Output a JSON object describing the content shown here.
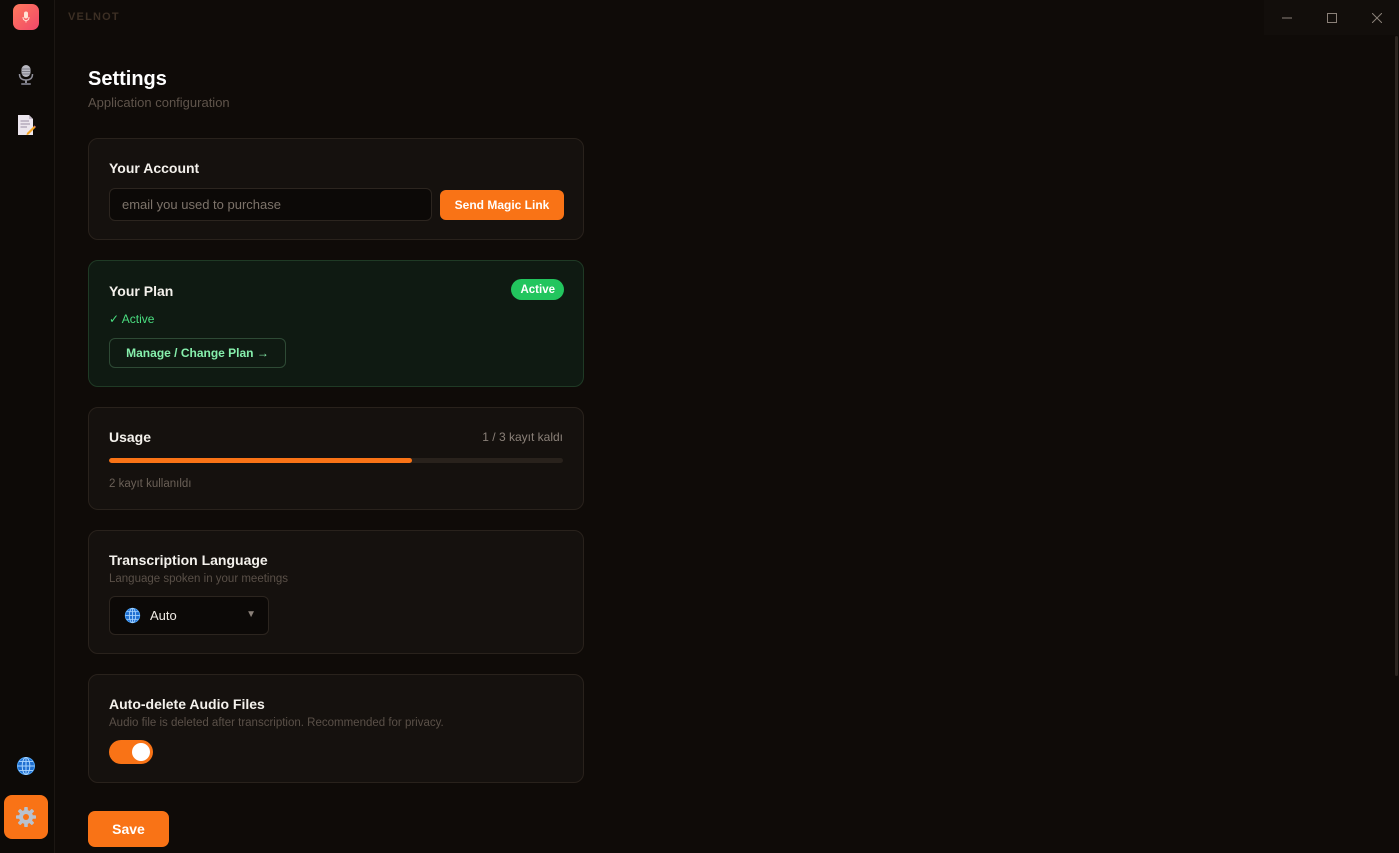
{
  "app": {
    "brand": "VELNOT"
  },
  "sidebar": {
    "items": [
      {
        "icon": "microphone-icon",
        "active": false
      },
      {
        "icon": "notes-icon",
        "active": false
      },
      {
        "icon": "globe-icon",
        "active": false
      },
      {
        "icon": "gear-icon",
        "active": true
      }
    ]
  },
  "window_controls": [
    "minimize",
    "maximize",
    "close"
  ],
  "page": {
    "title": "Settings",
    "subtitle": "Application configuration"
  },
  "account": {
    "title": "Your Account",
    "email_placeholder": "email you used to purchase",
    "email_value": "",
    "button_label": "Send Magic Link"
  },
  "plan": {
    "title": "Your Plan",
    "badge": "Active",
    "status": "✓ Active",
    "manage_label": "Manage / Change Plan →"
  },
  "usage": {
    "title": "Usage",
    "count_label": "1 / 3 kayıt kaldı",
    "used": 2,
    "total": 3,
    "note": "2 kayıt kullanıldı"
  },
  "language": {
    "title": "Transcription Language",
    "description": "Language spoken in your meetings",
    "selected": "Auto",
    "icon": "globe-icon"
  },
  "auto_delete": {
    "title": "Auto-delete Audio Files",
    "description": "Audio file is deleted after transcription. Recommended for privacy.",
    "enabled": true
  },
  "save_label": "Save",
  "colors": {
    "accent": "#f97316",
    "success": "#22c55e",
    "background": "#0f0b08",
    "card": "#15110e"
  }
}
